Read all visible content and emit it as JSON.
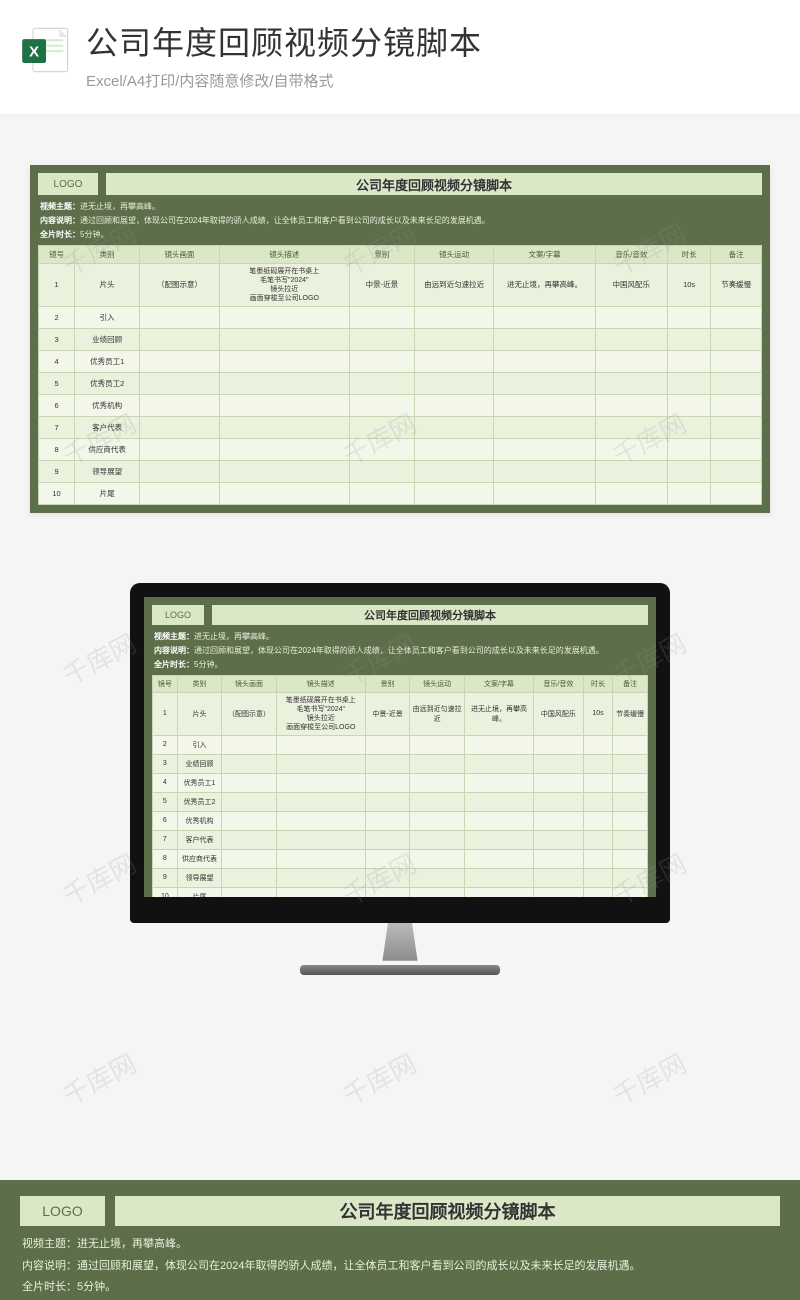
{
  "banner": {
    "title": "公司年度回顾视频分镜脚本",
    "subtitle": "Excel/A4打印/内容随意修改/自带格式"
  },
  "doc": {
    "logo": "LOGO",
    "title": "公司年度回顾视频分镜脚本",
    "theme_label": "视频主题：",
    "theme_value": "进无止境，再攀高峰。",
    "content_label": "内容说明：",
    "content_value": "通过回顾和展望，体现公司在2024年取得的骄人成绩，让全体员工和客户看到公司的成长以及未来长足的发展机遇。",
    "duration_label": "全片时长：",
    "duration_value": "5分钟。",
    "columns": [
      "镜号",
      "类别",
      "镜头画面",
      "镜头描述",
      "景别",
      "镜头运动",
      "文案/字幕",
      "音乐/音效",
      "时长",
      "备注"
    ],
    "rows": [
      {
        "no": "1",
        "cat": "片头",
        "pic": "（配图示意）",
        "desc": "笔墨纸砚展开在书桌上\n毛笔书写\"2024\"\n镜头拉近\n画面穿梭至公司LOGO",
        "shot": "中景-近景",
        "motion": "由远到近匀速拉近",
        "subtitle": "进无止境，再攀高峰。",
        "music": "中国风配乐",
        "dur": "10s",
        "note": "节奏缓慢"
      },
      {
        "no": "2",
        "cat": "引入",
        "pic": "",
        "desc": "",
        "shot": "",
        "motion": "",
        "subtitle": "",
        "music": "",
        "dur": "",
        "note": ""
      },
      {
        "no": "3",
        "cat": "业绩回顾",
        "pic": "",
        "desc": "",
        "shot": "",
        "motion": "",
        "subtitle": "",
        "music": "",
        "dur": "",
        "note": ""
      },
      {
        "no": "4",
        "cat": "优秀员工1",
        "pic": "",
        "desc": "",
        "shot": "",
        "motion": "",
        "subtitle": "",
        "music": "",
        "dur": "",
        "note": ""
      },
      {
        "no": "5",
        "cat": "优秀员工2",
        "pic": "",
        "desc": "",
        "shot": "",
        "motion": "",
        "subtitle": "",
        "music": "",
        "dur": "",
        "note": ""
      },
      {
        "no": "6",
        "cat": "优秀机构",
        "pic": "",
        "desc": "",
        "shot": "",
        "motion": "",
        "subtitle": "",
        "music": "",
        "dur": "",
        "note": ""
      },
      {
        "no": "7",
        "cat": "客户代表",
        "pic": "",
        "desc": "",
        "shot": "",
        "motion": "",
        "subtitle": "",
        "music": "",
        "dur": "",
        "note": ""
      },
      {
        "no": "8",
        "cat": "供应商代表",
        "pic": "",
        "desc": "",
        "shot": "",
        "motion": "",
        "subtitle": "",
        "music": "",
        "dur": "",
        "note": ""
      },
      {
        "no": "9",
        "cat": "领导展望",
        "pic": "",
        "desc": "",
        "shot": "",
        "motion": "",
        "subtitle": "",
        "music": "",
        "dur": "",
        "note": ""
      },
      {
        "no": "10",
        "cat": "片尾",
        "pic": "",
        "desc": "",
        "shot": "",
        "motion": "",
        "subtitle": "",
        "music": "",
        "dur": "",
        "note": ""
      }
    ]
  },
  "watermark": "千库网"
}
